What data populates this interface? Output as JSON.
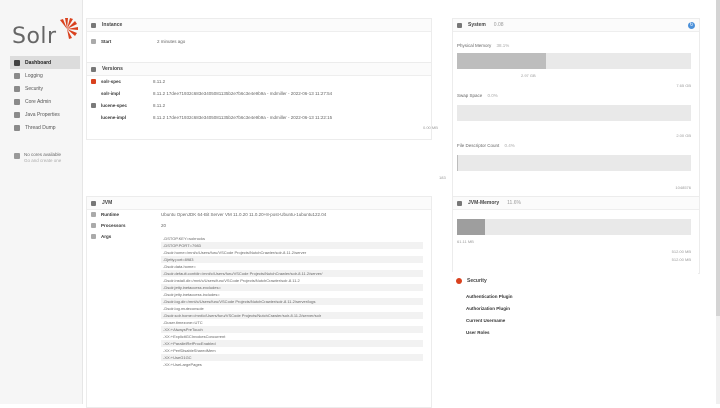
{
  "app": {
    "logo_text": "Solr"
  },
  "colors": {
    "accent": "#d9411e",
    "help": "#4a90d9"
  },
  "sidebar": {
    "items": [
      {
        "label": "Dashboard",
        "icon": "dashboard-icon"
      },
      {
        "label": "Logging",
        "icon": "logging-icon"
      },
      {
        "label": "Security",
        "icon": "security-icon"
      },
      {
        "label": "Core Admin",
        "icon": "core-admin-icon"
      },
      {
        "label": "Java Properties",
        "icon": "java-properties-icon"
      },
      {
        "label": "Thread Dump",
        "icon": "thread-dump-icon"
      }
    ],
    "no_cores": "No cores available",
    "no_cores_sub": "Go and create one"
  },
  "instance": {
    "title": "Instance",
    "start_label": "Start",
    "start_value": "2 minutes ago"
  },
  "versions": {
    "title": "Versions",
    "rows": [
      {
        "key": "solr-spec",
        "value": "8.11.2"
      },
      {
        "key": "solr-impl",
        "value": "8.11.2 17dee71932c683e3405081135b2e7b6c3e4e9b9a - mdmiller - 2022-06-13 11:27:54"
      },
      {
        "key": "lucene-spec",
        "value": "8.11.2"
      },
      {
        "key": "lucene-impl",
        "value": "8.11.2 17dee71932c683e3405081135b2e7b6c3e4e9b9a - mdmiller - 2022-06-13 11:22:15"
      }
    ]
  },
  "jvm": {
    "title": "JVM",
    "runtime_label": "Runtime",
    "runtime_value": "Ubuntu OpenJDK 64-Bit Server VM 11.0.20 11.0.20+8-post-Ubuntu-1ubuntu122.04",
    "processors_label": "Processors",
    "processors_value": "20",
    "args_label": "Args",
    "args": [
      "-DSTOP.KEY=solrrocks",
      "-DSTOP.PORT=7983",
      "-Dsolr.home=/mnt/c/Users/furu/VSCode Projects/NutchCrawler/solr-8.11.2/server",
      "-Djetty.port=8983",
      "-Dsolr.data.home=",
      "-Dsolr.default.confdir=/mnt/c/Users/furu/VSCode Projects/NutchCrawler/solr-8.11.2/server/",
      "-Dsolr.install.dir=/mnt/c/Users/furu/VSCode Projects/NutchCrawler/solr-8.11.2",
      "-Dsolr.jetty.inetaccess.excludes=",
      "-Dsolr.jetty.inetaccess.includes=",
      "-Dsolr.log.dir=/mnt/c/Users/furu/VSCode Projects/NutchCrawler/solr-8.11.2/server/logs",
      "-Dsolr.log.muteconsole",
      "-Dsolr.solr.home=/mnt/c/Users/furu/VSCode Projects/NutchCrawler/solr-8.11.2/server/solr",
      "-Duser.timezone=UTC",
      "-XX:+AlwaysPreTouch",
      "-XX:+ExplicitGCInvokesConcurrent",
      "-XX:+ParallelRefProcEnabled",
      "-XX:+PerfDisableSharedMem",
      "-XX:+UseG1GC",
      "-XX:+UseLargePages"
    ]
  },
  "system": {
    "title": "System",
    "load": "0.08",
    "physical_memory": {
      "label": "Physical Memory",
      "pct": "38.1%",
      "used": "2.97 GB",
      "total": "7.65 GB",
      "fraction": 0.38
    },
    "swap_space": {
      "label": "Swap Space",
      "pct": "0.0%",
      "left": "0.00 MB",
      "total": "2.00 GB",
      "fraction": 0.0
    },
    "file_descriptor": {
      "label": "File Descriptor Count",
      "pct": "0.4%",
      "used": "183",
      "total": "1048576",
      "fraction": 0.004
    }
  },
  "jvm_memory": {
    "title": "JVM-Memory",
    "pct": "11.6%",
    "used": "61.11 MB",
    "max1": "512.00 MB",
    "max2": "512.00 MB",
    "used_fraction": 0.12,
    "committed_fraction": 0.12
  },
  "security": {
    "title": "Security",
    "items": [
      "Authentication Plugin",
      "Authorization Plugin",
      "Current Username",
      "User Roles"
    ]
  }
}
